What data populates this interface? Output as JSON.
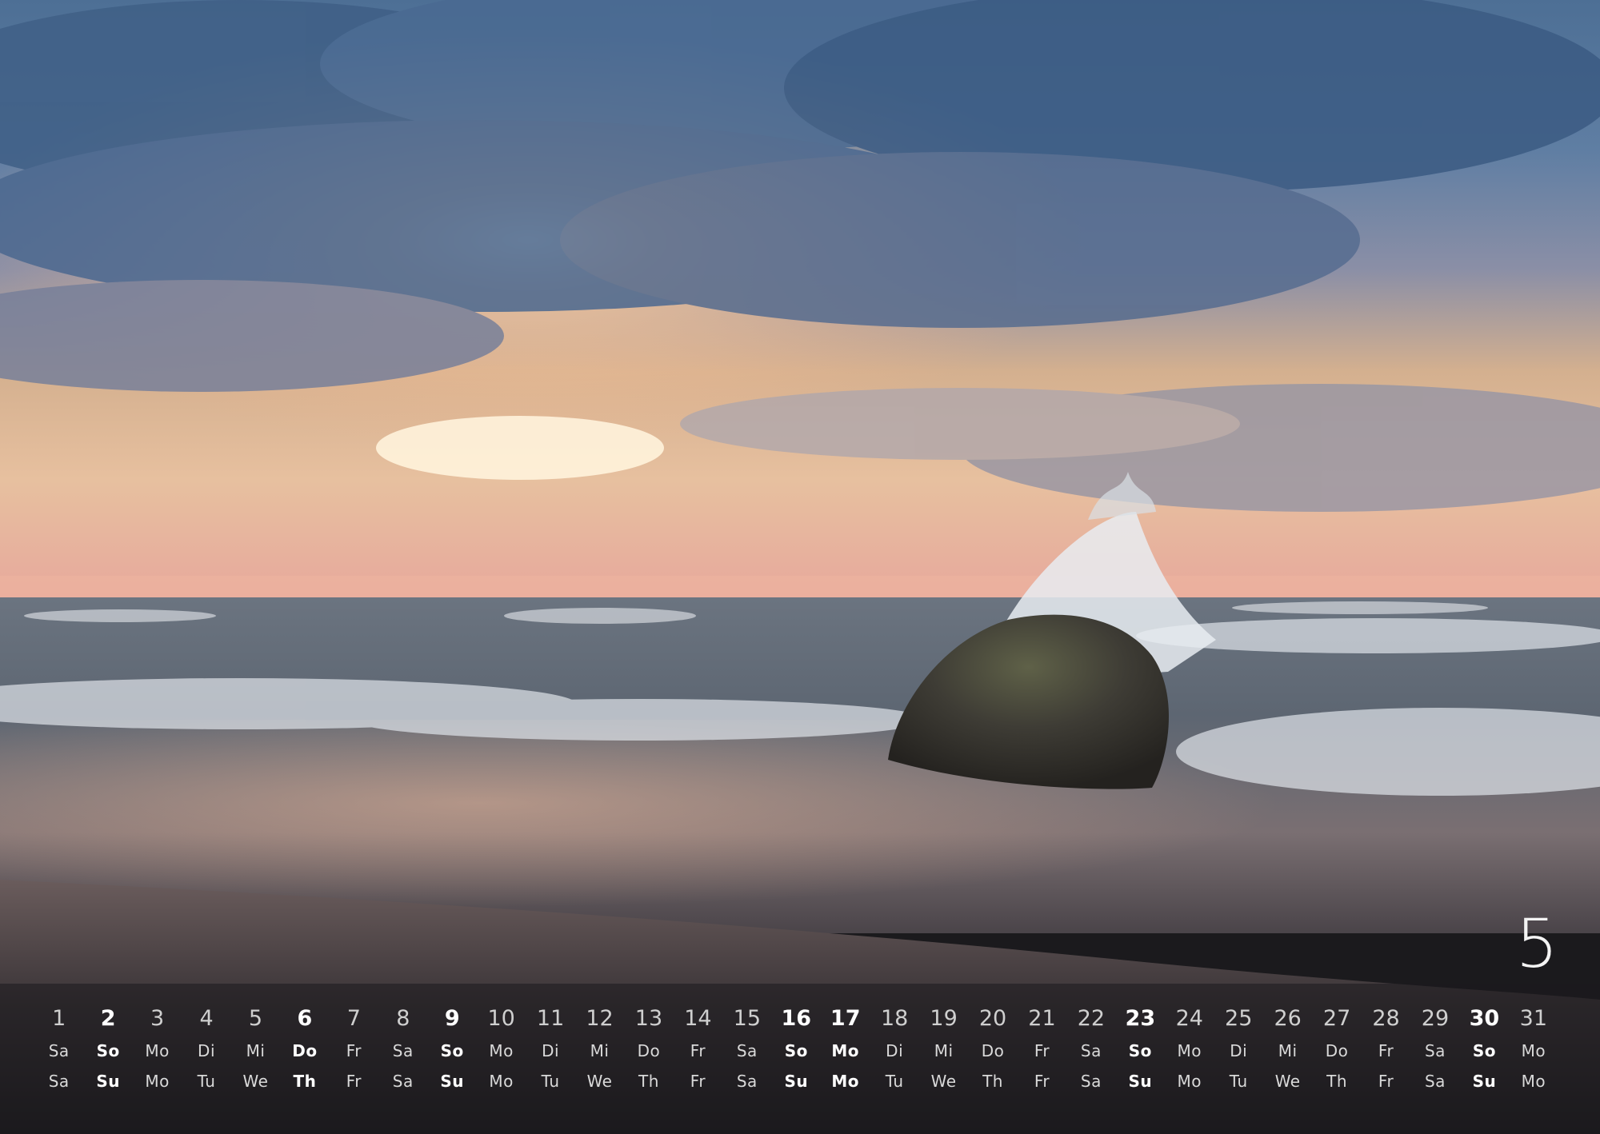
{
  "month": "5",
  "days": [
    "1",
    "2",
    "3",
    "4",
    "5",
    "6",
    "7",
    "8",
    "9",
    "10",
    "11",
    "12",
    "13",
    "14",
    "15",
    "16",
    "17",
    "18",
    "19",
    "20",
    "21",
    "22",
    "23",
    "24",
    "25",
    "26",
    "27",
    "28",
    "29",
    "30",
    "31"
  ],
  "weekdays_de": [
    "Sa",
    "So",
    "Mo",
    "Di",
    "Mi",
    "Do",
    "Fr",
    "Sa",
    "So",
    "Mo",
    "Di",
    "Mi",
    "Do",
    "Fr",
    "Sa",
    "So",
    "Mo",
    "Di",
    "Mi",
    "Do",
    "Fr",
    "Sa",
    "So",
    "Mo",
    "Di",
    "Mi",
    "Do",
    "Fr",
    "Sa",
    "So",
    "Mo"
  ],
  "weekdays_en": [
    "Sa",
    "Su",
    "Mo",
    "Tu",
    "We",
    "Th",
    "Fr",
    "Sa",
    "Su",
    "Mo",
    "Tu",
    "We",
    "Th",
    "Fr",
    "Sa",
    "Su",
    "Mo",
    "Tu",
    "We",
    "Th",
    "Fr",
    "Sa",
    "Su",
    "Mo",
    "Tu",
    "We",
    "Th",
    "Fr",
    "Sa",
    "Su",
    "Mo"
  ],
  "highlighted_days": [
    "2",
    "6",
    "9",
    "16",
    "17",
    "23",
    "30"
  ],
  "colors": {
    "text": "#d8d8d8",
    "highlight": "#ffffff",
    "weekend_dim": "#9e9e9e"
  }
}
